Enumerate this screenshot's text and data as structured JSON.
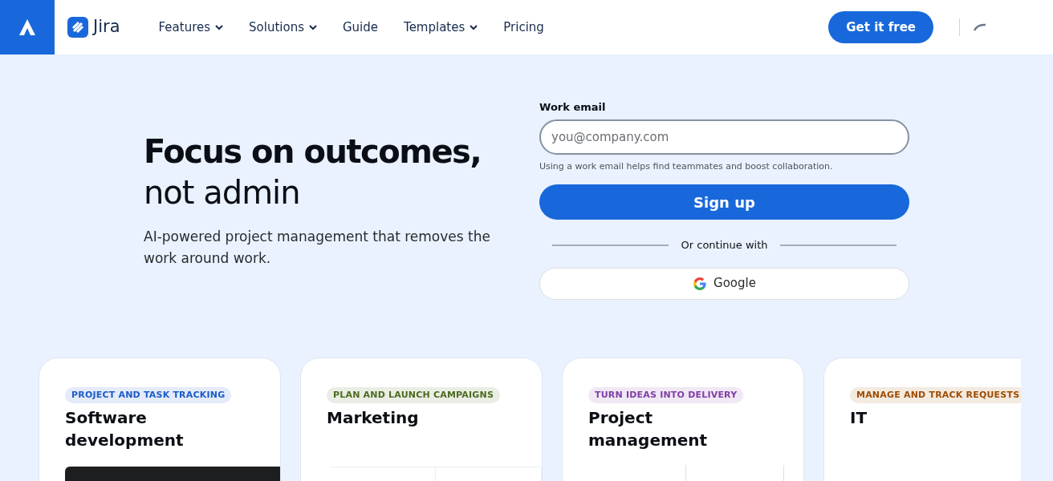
{
  "nav": {
    "brand": "Jira",
    "items": [
      {
        "label": "Features",
        "dropdown": true
      },
      {
        "label": "Solutions",
        "dropdown": true
      },
      {
        "label": "Guide",
        "dropdown": false
      },
      {
        "label": "Templates",
        "dropdown": true
      },
      {
        "label": "Pricing",
        "dropdown": false
      }
    ],
    "cta": "Get it free"
  },
  "hero": {
    "title": "Focus on outcomes,",
    "subtitle": "not admin",
    "description": "AI-powered project management that removes the work around work."
  },
  "signup": {
    "label": "Work email",
    "placeholder": "you@company.com",
    "hint": "Using a work email helps find teammates and boost collaboration.",
    "submit": "Sign up",
    "divider": "Or continue with",
    "google": "Google"
  },
  "cards": [
    {
      "tag": "PROJECT AND TASK TRACKING",
      "color": "#1c5bc9",
      "title": "Software development",
      "kind": "dark"
    },
    {
      "tag": "PLAN AND LAUNCH CAMPAIGNS",
      "color": "#4c6b1f",
      "title": "Marketing",
      "kind": "calendar"
    },
    {
      "tag": "TURN IDEAS INTO DELIVERY",
      "color": "#803fa5",
      "title": "Project management",
      "kind": "columns"
    },
    {
      "tag": "MANAGE AND TRACK REQUESTS",
      "color": "#9e4c00",
      "title": "IT",
      "kind": "plain"
    }
  ]
}
